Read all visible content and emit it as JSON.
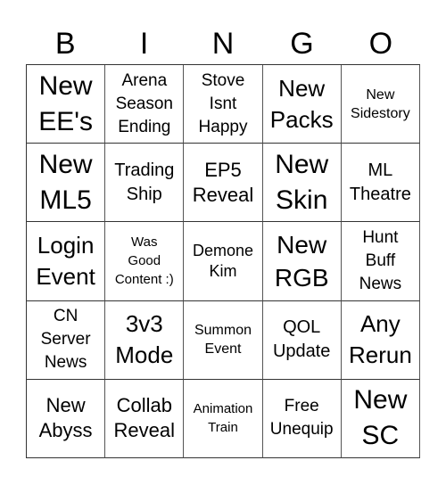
{
  "card": {
    "header": [
      "B",
      "I",
      "N",
      "G",
      "O"
    ],
    "cells": [
      [
        "New\nEE's",
        "Arena\nSeason\nEnding",
        "Stove\nIsnt\nHappy",
        "New\nPacks",
        "New\nSidestory"
      ],
      [
        "New\nML5",
        "Trading\nShip",
        "EP5\nReveal",
        "New\nSkin",
        "ML\nTheatre"
      ],
      [
        "Login\nEvent",
        "Was\nGood\nContent :)",
        "Demone\nKim",
        "New\nRGB",
        "Hunt\nBuff\nNews"
      ],
      [
        "CN\nServer\nNews",
        "3v3\nMode",
        "Summon\nEvent",
        "QOL\nUpdate",
        "Any\nRerun"
      ],
      [
        "New\nAbyss",
        "Collab\nReveal",
        "Animation\nTrain",
        "Free\nUnequip",
        "New\nSC"
      ]
    ]
  }
}
